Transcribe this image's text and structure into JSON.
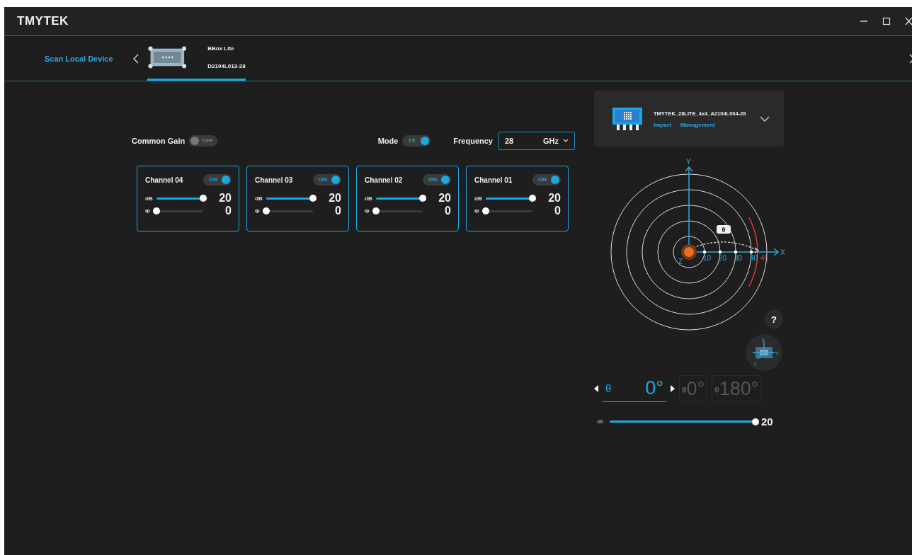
{
  "window": {
    "title": "TMYTEK"
  },
  "device_bar": {
    "scan_link": "Scan Local Device",
    "tabs": [
      {
        "name": "BBox Lite",
        "serial": "D2104L013-28",
        "selected": true
      }
    ]
  },
  "common_gain": {
    "label": "Common Gain",
    "state": "OFF",
    "on": false
  },
  "mode": {
    "label": "Mode",
    "state": "TX",
    "on": true
  },
  "frequency": {
    "label": "Frequency",
    "value": "28",
    "unit": "GHz"
  },
  "channels": [
    {
      "name": "Channel 04",
      "state": "ON",
      "on": true,
      "gain": {
        "label": "dB",
        "level": 1,
        "reading": "20"
      },
      "phase": {
        "label": "Φ",
        "level": 0,
        "reading": "0"
      }
    },
    {
      "name": "Channel 03",
      "state": "ON",
      "on": true,
      "gain": {
        "label": "dB",
        "level": 1,
        "reading": "20"
      },
      "phase": {
        "label": "Φ",
        "level": 0,
        "reading": "0"
      }
    },
    {
      "name": "Channel 02",
      "state": "ON",
      "on": true,
      "gain": {
        "label": "dB",
        "level": 1,
        "reading": "20"
      },
      "phase": {
        "label": "Φ",
        "level": 0,
        "reading": "0"
      }
    },
    {
      "name": "Channel 01",
      "state": "ON",
      "on": true,
      "gain": {
        "label": "dB",
        "level": 1,
        "reading": "20"
      },
      "phase": {
        "label": "Φ",
        "level": 0,
        "reading": "0"
      }
    }
  ],
  "antenna": {
    "name": "TMYTEK_28LITE_4x4_A2104L004-28",
    "links": [
      "Import",
      "Management"
    ]
  },
  "polar_plot": {
    "y_axis": "Y",
    "x_axis": "X",
    "z_axis": "Z",
    "rings": [
      "10",
      "20",
      "30",
      "40"
    ],
    "limit": "45",
    "angle_tag": "θ"
  },
  "help": "?",
  "orientation_axes": [
    "y",
    "x",
    "z"
  ],
  "steering": {
    "theta_label": "θ",
    "theta_value": "0°",
    "phi_fields": [
      {
        "prefix": "φ",
        "value": "0°",
        "disabled": true
      },
      {
        "prefix": "φ",
        "value": "180°",
        "disabled": true
      }
    ]
  },
  "beam_gain": {
    "label": "dB",
    "level": 1,
    "reading": "20"
  }
}
